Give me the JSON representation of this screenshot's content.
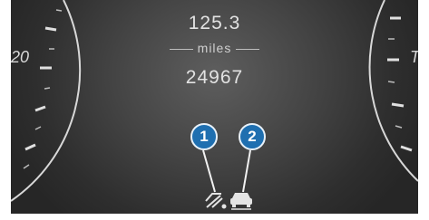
{
  "cluster": {
    "trip_value": "125.3",
    "trip_unit": "miles",
    "odometer_value": "24967",
    "left_dial_label": "20",
    "right_dial_label": "T"
  },
  "callouts": {
    "one": "1",
    "two": "2"
  },
  "icons": {
    "assist_off": "driving-assist-off-icon",
    "vehicle_ahead": "vehicle-ahead-icon"
  },
  "colors": {
    "callout_fill": "#1f6fb0",
    "display_text": "#e2e2e2"
  }
}
